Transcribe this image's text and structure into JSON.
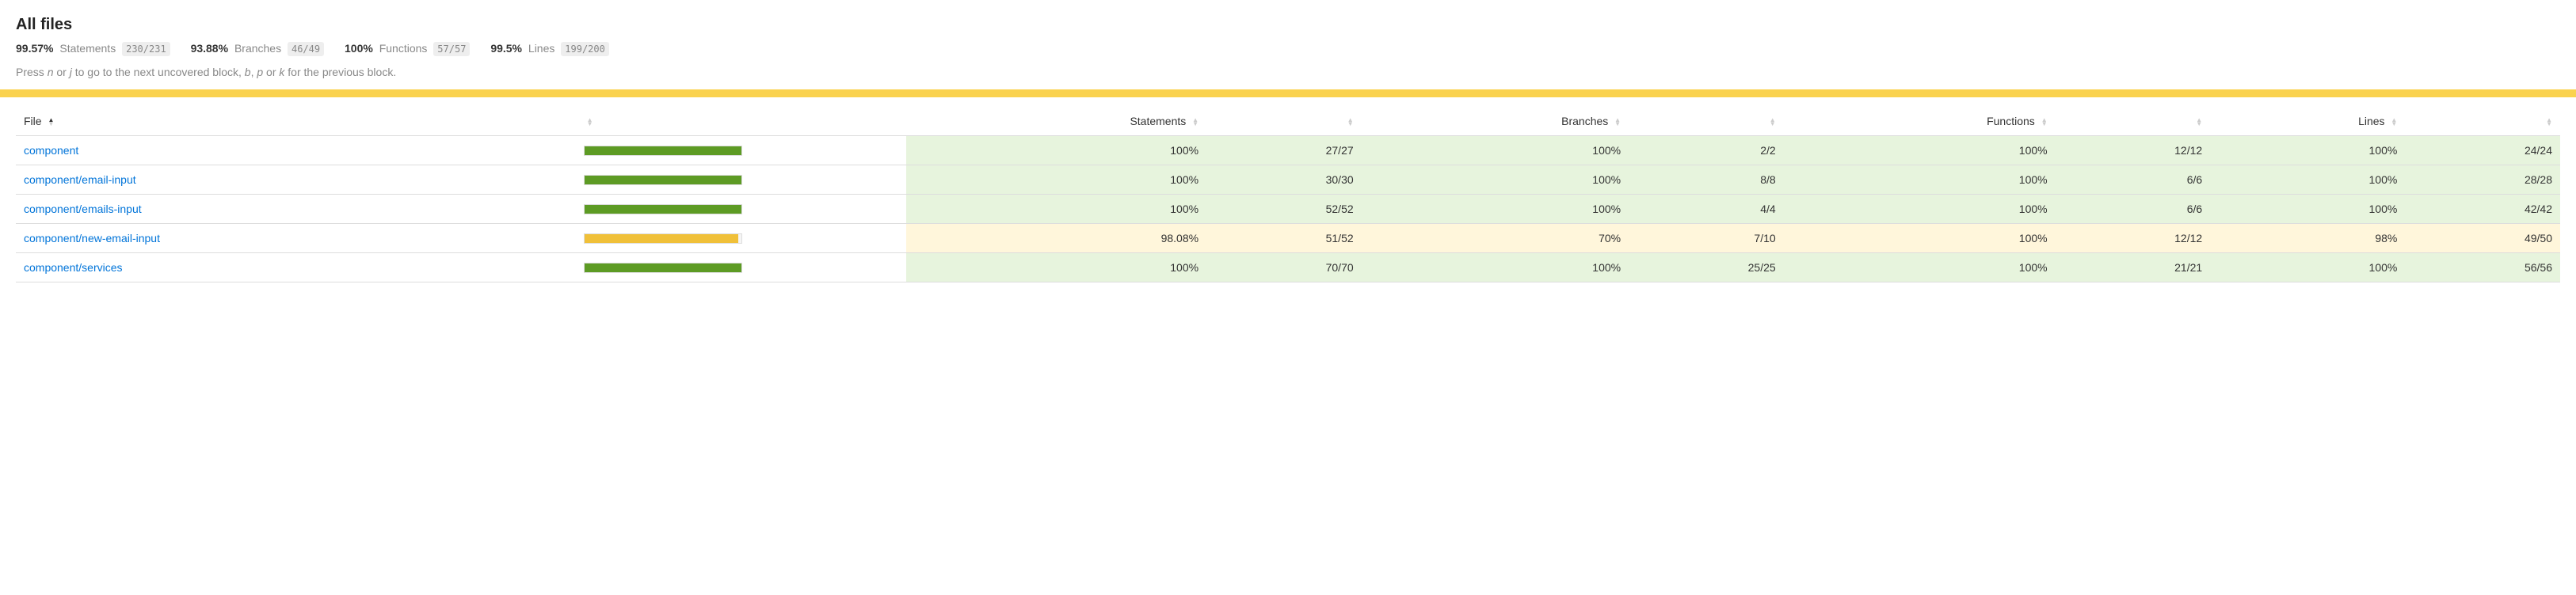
{
  "title": "All files",
  "summary": {
    "statements": {
      "pct": "99.57%",
      "label": "Statements",
      "frac": "230/231"
    },
    "branches": {
      "pct": "93.88%",
      "label": "Branches",
      "frac": "46/49"
    },
    "functions": {
      "pct": "100%",
      "label": "Functions",
      "frac": "57/57"
    },
    "lines": {
      "pct": "99.5%",
      "label": "Lines",
      "frac": "199/200"
    }
  },
  "hint": {
    "prefix": "Press ",
    "k1": "n",
    "or1": " or ",
    "k2": "j",
    "mid": " to go to the next uncovered block, ",
    "k3": "b",
    "sep": ", ",
    "k4": "p",
    "or2": " or ",
    "k5": "k",
    "suffix": " for the previous block."
  },
  "columns": {
    "file": "File",
    "statements": "Statements",
    "branches": "Branches",
    "functions": "Functions",
    "lines": "Lines"
  },
  "rows": [
    {
      "name": "component",
      "level": "high",
      "bar_pct": 100,
      "statements_pct": "100%",
      "statements_frac": "27/27",
      "branches_pct": "100%",
      "branches_frac": "2/2",
      "functions_pct": "100%",
      "functions_frac": "12/12",
      "lines_pct": "100%",
      "lines_frac": "24/24"
    },
    {
      "name": "component/email-input",
      "level": "high",
      "bar_pct": 100,
      "statements_pct": "100%",
      "statements_frac": "30/30",
      "branches_pct": "100%",
      "branches_frac": "8/8",
      "functions_pct": "100%",
      "functions_frac": "6/6",
      "lines_pct": "100%",
      "lines_frac": "28/28"
    },
    {
      "name": "component/emails-input",
      "level": "high",
      "bar_pct": 100,
      "statements_pct": "100%",
      "statements_frac": "52/52",
      "branches_pct": "100%",
      "branches_frac": "4/4",
      "functions_pct": "100%",
      "functions_frac": "6/6",
      "lines_pct": "100%",
      "lines_frac": "42/42"
    },
    {
      "name": "component/new-email-input",
      "level": "medium",
      "bar_pct": 98,
      "statements_pct": "98.08%",
      "statements_frac": "51/52",
      "branches_pct": "70%",
      "branches_frac": "7/10",
      "functions_pct": "100%",
      "functions_frac": "12/12",
      "lines_pct": "98%",
      "lines_frac": "49/50"
    },
    {
      "name": "component/services",
      "level": "high",
      "bar_pct": 100,
      "statements_pct": "100%",
      "statements_frac": "70/70",
      "branches_pct": "100%",
      "branches_frac": "25/25",
      "functions_pct": "100%",
      "functions_frac": "21/21",
      "lines_pct": "100%",
      "lines_frac": "56/56"
    }
  ]
}
